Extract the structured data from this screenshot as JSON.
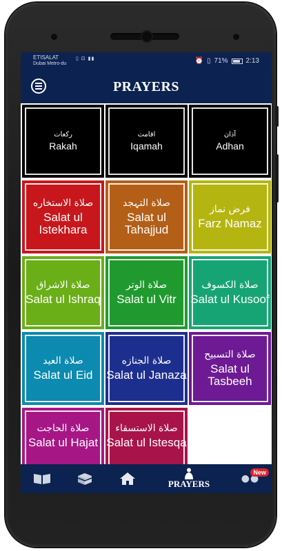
{
  "status_bar": {
    "carrier": "ETISALAT",
    "network_name": "Dubai Metro-du",
    "battery": "71%",
    "time": "2:13"
  },
  "app_bar": {
    "title": "PRAYERS",
    "menu_icon": "menu-icon"
  },
  "tiles": [
    {
      "arabic": "ركعات",
      "english": "Rakah",
      "color": "#000000"
    },
    {
      "arabic": "اقامت",
      "english": "Iqamah",
      "color": "#000000"
    },
    {
      "arabic": "آذان",
      "english": "Adhan",
      "color": "#000000"
    },
    {
      "arabic": "صلاة الاستخاره",
      "english": "Salat ul Istekhara",
      "color": "#c7171c"
    },
    {
      "arabic": "صلاة التہجد",
      "english": "Salat ul Tahajjud",
      "color": "#b35f17"
    },
    {
      "arabic": "فرض نماز",
      "english": "Farz Namaz",
      "color": "#b5b511"
    },
    {
      "arabic": "صلاة الاشراق",
      "english": "Salat ul Ishraq",
      "color": "#6aae18"
    },
    {
      "arabic": "صلاة الوتر",
      "english": "Salat ul Vitr",
      "color": "#209a2e"
    },
    {
      "arabic": "صلاة الکسوف",
      "english": "Salat ul Kusoof",
      "color": "#17a474"
    },
    {
      "arabic": "صلاة العيد",
      "english": "Salat ul Eid",
      "color": "#0c8ab0"
    },
    {
      "arabic": "صلاة الجنازه",
      "english": "Salat ul Janaza",
      "color": "#1d2f8e"
    },
    {
      "arabic": "صلاة التسبیح",
      "english": "Salat ul Tasbeeh",
      "color": "#6d1a94"
    },
    {
      "arabic": "صلاة الحاجت",
      "english": "Salat ul Hajat",
      "color": "#a61785"
    },
    {
      "arabic": "صلاة الاستسقاء",
      "english": "Salat ul Istesqa",
      "color": "#a81449"
    }
  ],
  "bottom_nav": {
    "items": [
      "book-icon",
      "kaaba-icon",
      "home-icon"
    ],
    "active_label": "PRAYERS",
    "more_badge": "New"
  }
}
